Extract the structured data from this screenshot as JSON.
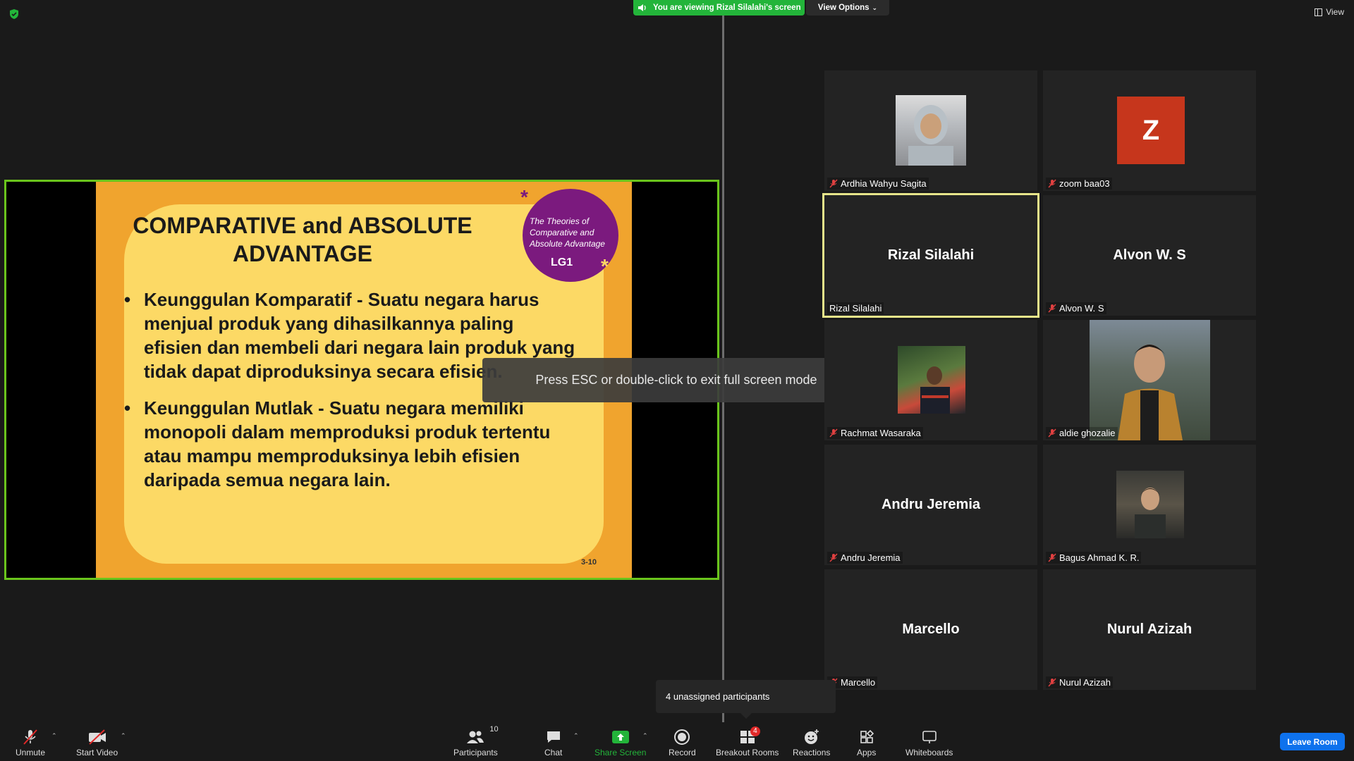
{
  "banner": {
    "viewing_text": "You are viewing Rizal Silalahi's screen",
    "view_options_label": "View Options",
    "view_label": "View"
  },
  "slide": {
    "title_line1": "COMPARATIVE and ABSOLUTE",
    "title_line2": "ADVANTAGE",
    "badge_text": "The Theories of Comparative and Absolute Advantage",
    "badge_lg": "LG1",
    "bullet1": "Keunggulan Komparatif - Suatu negara harus menjual produk yang dihasilkannya paling efisien dan membeli dari negara lain produk yang tidak dapat diproduksinya secara efisien.",
    "bullet2": "Keunggulan Mutlak - Suatu negara memiliki monopoli dalam memproduksi produk tertentu atau mampu memproduksinya lebih efisien daripada semua negara lain.",
    "page": "3-10"
  },
  "esc_toast": "Press ESC or double-click to exit full screen mode",
  "participants": [
    {
      "name": "Ardhia Wahyu Sagita",
      "center": ""
    },
    {
      "name": "zoom baa03",
      "center": "Z"
    },
    {
      "name": "Rizal Silalahi",
      "center": "Rizal Silalahi"
    },
    {
      "name": "Alvon W. S",
      "center": "Alvon W. S"
    },
    {
      "name": "Rachmat Wasaraka",
      "center": ""
    },
    {
      "name": "aldie ghozalie",
      "center": ""
    },
    {
      "name": "Andru Jeremia",
      "center": "Andru Jeremia"
    },
    {
      "name": "Bagus Ahmad K. R.",
      "center": ""
    },
    {
      "name": "Marcello",
      "center": "Marcello"
    },
    {
      "name": "Nurul Azizah",
      "center": "Nurul Azizah"
    }
  ],
  "unassigned": "4 unassigned participants",
  "toolbar": {
    "unmute": "Unmute",
    "start_video": "Start Video",
    "participants": "Participants",
    "participants_count": "10",
    "chat": "Chat",
    "share_screen": "Share Screen",
    "record": "Record",
    "breakout_rooms": "Breakout Rooms",
    "breakout_count": "4",
    "reactions": "Reactions",
    "apps": "Apps",
    "whiteboards": "Whiteboards",
    "leave": "Leave Room"
  },
  "colors": {
    "share_green": "#23b43a",
    "active_speaker": "#e7e58a",
    "leave_blue": "#0e72ed",
    "slide_orange": "#f0a42e",
    "slide_yellow": "#fcd965"
  }
}
